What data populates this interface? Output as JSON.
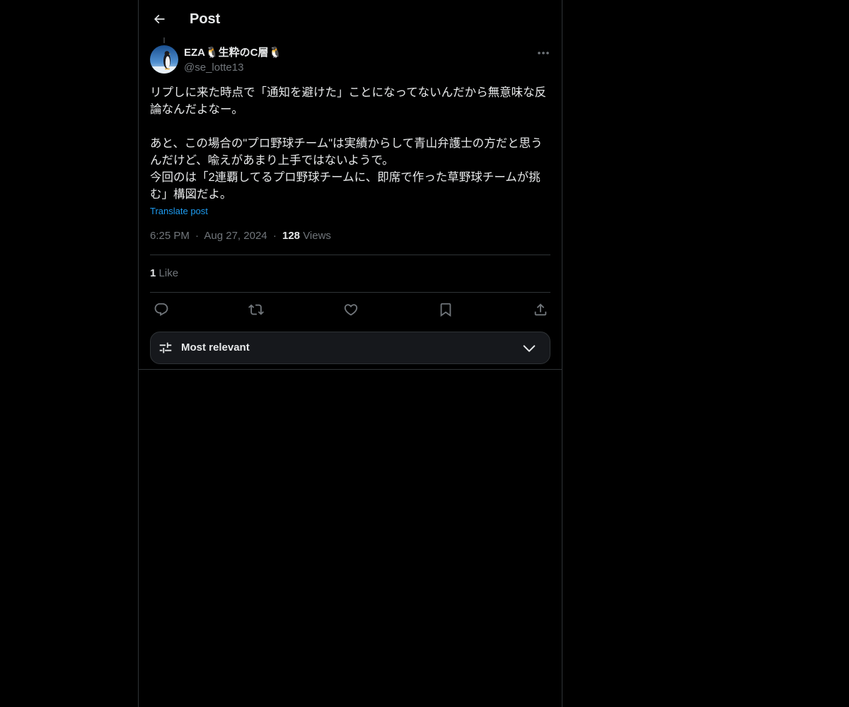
{
  "header": {
    "title": "Post"
  },
  "post": {
    "display_name": "EZA🐧生粋のC層🐧",
    "handle": "@se_lotte13",
    "text": "リプしに来た時点で「通知を避けた」ことになってないんだから無意味な反論なんだよなー。\n\nあと、この場合の\"プロ野球チーム\"は実績からして青山弁護士の方だと思うんだけど、喩えがあまり上手ではないようで。\n今回のは「2連覇してるプロ野球チームに、即席で作った草野球チームが挑む」構図だよ。",
    "translate_label": "Translate post",
    "time": "6:25 PM",
    "date": "Aug 27, 2024",
    "separator": "·",
    "views_count": "128",
    "views_label": "Views",
    "likes_count": "1",
    "likes_label": "Like"
  },
  "actions": {
    "reply_icon": "reply-icon",
    "repost_icon": "repost-icon",
    "like_icon": "heart-icon",
    "bookmark_icon": "bookmark-icon",
    "share_icon": "share-icon"
  },
  "sort": {
    "label": "Most relevant"
  },
  "colors": {
    "background": "#000000",
    "text": "#e7e9ea",
    "muted": "#71767b",
    "accent": "#1d9bf0",
    "border": "#2f3336"
  }
}
